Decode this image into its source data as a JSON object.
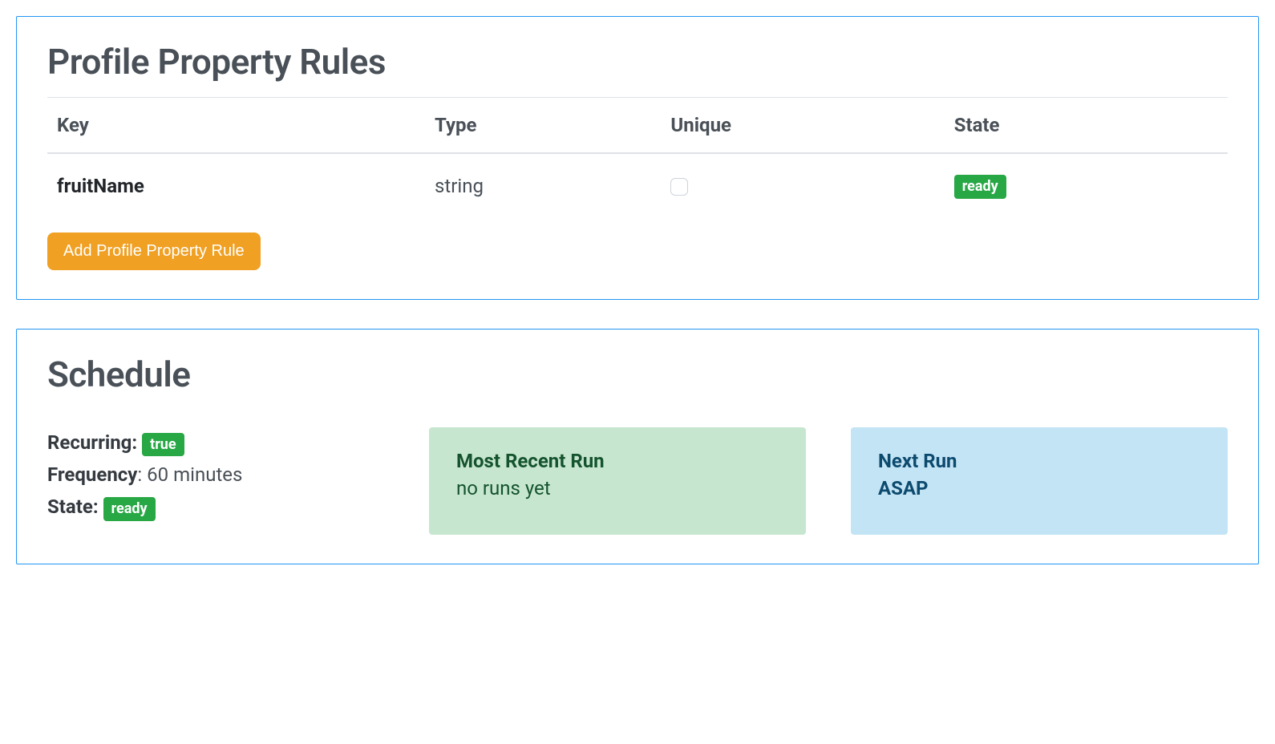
{
  "rules_panel": {
    "title": "Profile Property Rules",
    "columns": {
      "key": "Key",
      "type": "Type",
      "unique": "Unique",
      "state": "State"
    },
    "rows": [
      {
        "key": "fruitName",
        "type": "string",
        "unique_checked": false,
        "state": "ready"
      }
    ],
    "add_button": "Add Profile Property Rule"
  },
  "schedule_panel": {
    "title": "Schedule",
    "recurring_label": "Recurring",
    "recurring_value": "true",
    "frequency_label": "Frequency",
    "frequency_value": "60 minutes",
    "state_label": "State",
    "state_value": "ready",
    "recent_run": {
      "title": "Most Recent Run",
      "body": "no runs yet"
    },
    "next_run": {
      "title": "Next Run",
      "body": "ASAP"
    }
  }
}
